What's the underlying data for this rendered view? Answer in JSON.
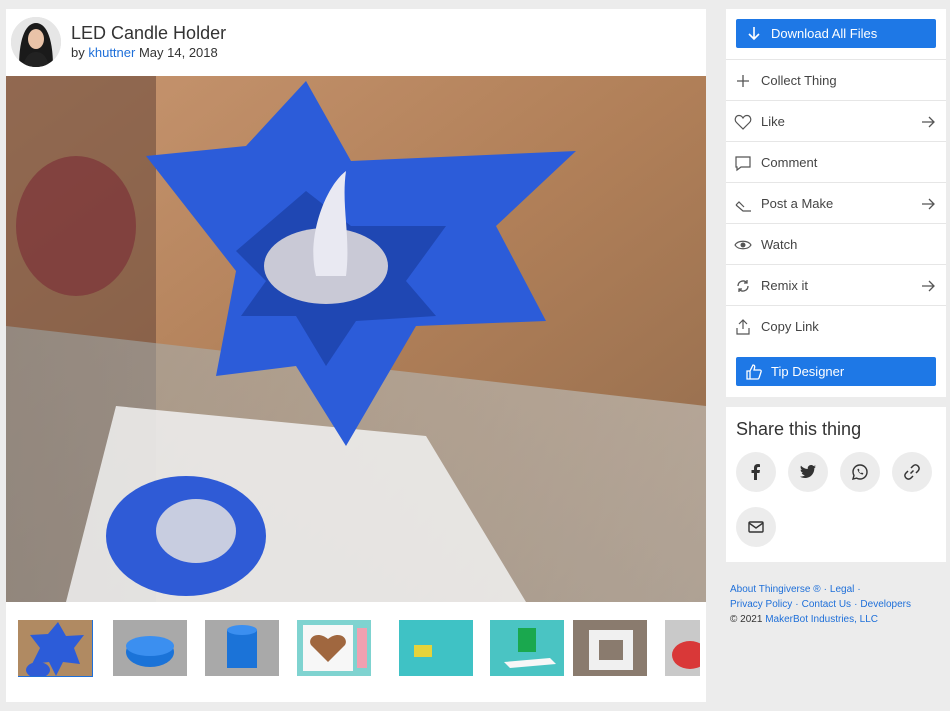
{
  "thing": {
    "title": "LED Candle Holder",
    "by": "by",
    "author": "khuttner",
    "date": "May 14, 2018"
  },
  "thumbnails": [
    "thumb-1",
    "thumb-2",
    "thumb-3",
    "thumb-4",
    "thumb-5",
    "thumb-6",
    "thumb-7",
    "thumb-8"
  ],
  "actions": {
    "download": "Download All Files",
    "collect": "Collect Thing",
    "like": "Like",
    "comment": "Comment",
    "post_make": "Post a Make",
    "watch": "Watch",
    "remix": "Remix it",
    "copy_link": "Copy Link",
    "tip": "Tip Designer"
  },
  "share": {
    "title": "Share this thing",
    "icons": [
      "facebook-icon",
      "twitter-icon",
      "whatsapp-icon",
      "link-icon",
      "email-icon"
    ]
  },
  "footer": {
    "about": "About Thingiverse ®",
    "legal": "Legal",
    "privacy": "Privacy Policy",
    "contact": "Contact Us",
    "developers": "Developers",
    "copyright": "©  2021",
    "company": "MakerBot Industries, LLC"
  },
  "colors": {
    "accent": "#1e78e6",
    "link": "#1e6fd9",
    "background": "#ececec"
  }
}
